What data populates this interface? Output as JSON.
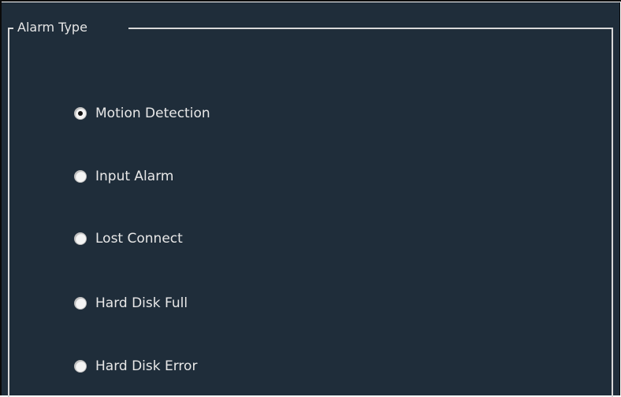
{
  "group": {
    "title": "Alarm Type"
  },
  "options": [
    {
      "label": "Motion Detection",
      "selected": true
    },
    {
      "label": "Input Alarm",
      "selected": false
    },
    {
      "label": "Lost Connect",
      "selected": false
    },
    {
      "label": "Hard Disk Full",
      "selected": false
    },
    {
      "label": "Hard Disk Error",
      "selected": false
    }
  ],
  "colors": {
    "background": "#1f2d3a",
    "text": "#e8e8e8",
    "radio_fill": "#f4f4f4",
    "radio_dot": "#111111"
  }
}
